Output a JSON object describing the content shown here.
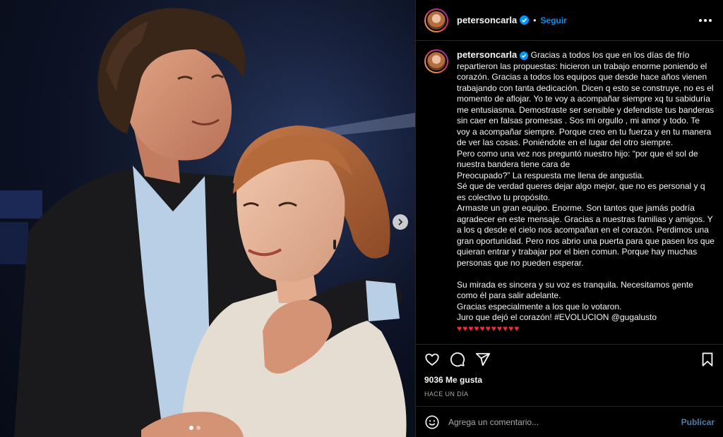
{
  "post": {
    "username": "petersoncarla",
    "follow_label": "Seguir",
    "separator": "•",
    "caption": "Gracias a todos los que en los días de frío repartieron las propuestas: hicieron un trabajo enorme poniendo el corazón. Gracias a todos los equipos que desde hace años vienen trabajando con tanta dedicación. Dicen q esto se construye, no es el momento de aflojar. Yo te voy a acompañar siempre xq tu sabiduría me entusiasma. Demostraste ser sensible y defendiste tus banderas sin caer en falsas promesas . Sos mi orgullo , mi amor y todo. Te voy a acompañar siempre. Porque creo en tu fuerza y en tu manera de ver las cosas. Poniéndote en el lugar del otro siempre.\nPero como una vez nos preguntó nuestro hijo: “por que el sol de nuestra bandera tiene cara de\nPreocupado?” La respuesta me llena de angustia.\nSé que de verdad queres dejar algo mejor, que no es personal y q es colectivo tu propósito.\nArmaste un gran equipo. Enorme. Son tantos que jamás podría agradecer en este mensaje. Gracias a nuestras familias y amigos. Y a los q desde el cielo nos acompañan en el corazón. Perdimos una gran oportunidad. Pero nos abrio una puerta para que pasen los que quieran entrar y trabajar por el bien comun. Porque hay muchas personas que no pueden esperar.\n\nSu mirada es sincera y su voz es tranquila. Necesitamos gente como él para salir adelante.\nGracias especialmente a los que lo votaron.\nJuro que dejó el corazón! #EVOLUCION @gugalusto",
    "hearts": "♥♥♥♥♥♥♥♥♥♥♥",
    "likes": "9036 Me gusta",
    "time": "HACE UN DÍA"
  },
  "comment": {
    "placeholder": "Agrega un comentario...",
    "publish_label": "Publicar"
  },
  "carousel": {
    "total": 2,
    "current": 1
  },
  "colors": {
    "follow": "#0095f6",
    "verified": "#0095f6",
    "heart": "#ed2b3d",
    "background": "#000000"
  },
  "icons": [
    "verified-badge-icon",
    "more-options-icon",
    "heart-icon",
    "comment-icon",
    "share-icon",
    "bookmark-icon",
    "emoji-icon",
    "chevron-right-icon"
  ]
}
